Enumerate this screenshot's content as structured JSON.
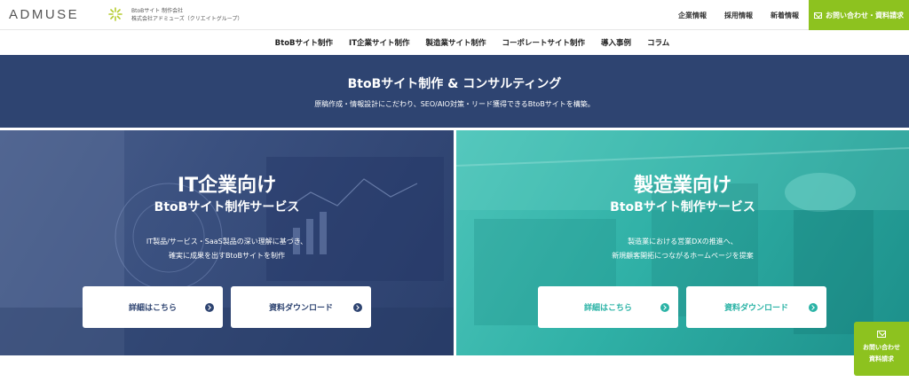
{
  "header": {
    "logo": "ADMUSE",
    "company_line1": "BtoBサイト 制作会社",
    "company_line2": "株式会社アドミューズ（クリエイトグループ）",
    "nav": [
      "企業情報",
      "採用情報",
      "新着情報"
    ],
    "cta": "お問い合わせ・資料請求"
  },
  "subnav": [
    "BtoBサイト制作",
    "IT企業サイト制作",
    "製造業サイト制作",
    "コーポレートサイト制作",
    "導入事例",
    "コラム"
  ],
  "hero": {
    "title": "BtoBサイト制作 & コンサルティング",
    "subtitle": "原稿作成・情報設計にこだわり、SEO/AIO対策・リード獲得できるBtoBサイトを構築。"
  },
  "panels": {
    "it": {
      "title": "IT企業向け",
      "subtitle": "BtoBサイト制作サービス",
      "desc_line1": "IT製品/サービス・SaaS製品の深い理解に基づき、",
      "desc_line2": "確実に成果を出すBtoBサイトを制作",
      "detail_button": "詳細はこちら",
      "download_button": "資料ダウンロード"
    },
    "mfg": {
      "title": "製造業向け",
      "subtitle": "BtoBサイト制作サービス",
      "desc_line1": "製造業における営業DXの推進へ、",
      "desc_line2": "新規顧客開拓につながるホームページを提案",
      "detail_button": "詳細はこちら",
      "download_button": "資料ダウンロード"
    }
  },
  "floating_cta": {
    "line1": "お問い合わせ",
    "line2": "資料請求"
  },
  "colors": {
    "navy": "#2e4471",
    "green": "#8dc21f",
    "teal": "#2bb3a6"
  },
  "icons": [
    "logo-mark-icon",
    "mail-icon",
    "arrow-circle-icon"
  ]
}
